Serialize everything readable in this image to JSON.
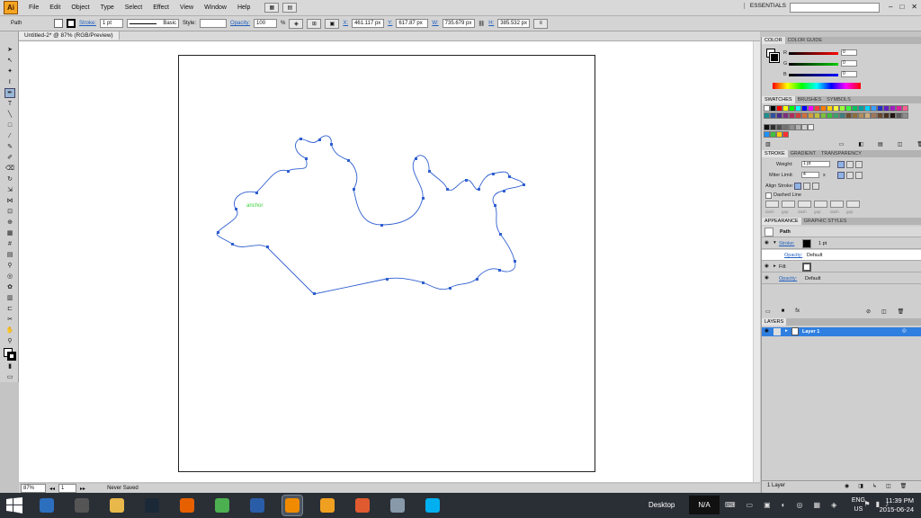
{
  "app": {
    "logo": "Ai"
  },
  "menu": [
    "File",
    "Edit",
    "Object",
    "Type",
    "Select",
    "Effect",
    "View",
    "Window",
    "Help"
  ],
  "workspace": "ESSENTIALS",
  "search_placeholder": "",
  "control": {
    "selection": "Path",
    "stroke_label": "Stroke:",
    "stroke_weight": "1 pt",
    "brush": "Basic",
    "style_label": "Style:",
    "opacity_label": "Opacity:",
    "opacity_value": "100",
    "opacity_unit": "%",
    "x_label": "X:",
    "x_value": "461.117 px",
    "y_label": "Y:",
    "y_value": "617.87 px",
    "w_label": "W:",
    "w_value": "735.679 px",
    "h_label": "H:",
    "h_value": "385.532 px"
  },
  "document": {
    "tab": "Untitled-2* @ 87% (RGB/Preview)",
    "zoom": "87%",
    "artboard": "1",
    "status": "Never Saved",
    "anchor_hint": "anchor"
  },
  "color_panel": {
    "tabs": [
      "COLOR",
      "COLOR GUIDE"
    ],
    "channels": [
      {
        "label": "R",
        "value": "0",
        "color": "#d02020"
      },
      {
        "label": "G",
        "value": "0",
        "color": "#20a020"
      },
      {
        "label": "B",
        "value": "0",
        "color": "#2030d0"
      }
    ]
  },
  "swatches_panel": {
    "tabs": [
      "SWATCHES",
      "BRUSHES",
      "SYMBOLS"
    ],
    "row1": [
      "#ffffff",
      "#000000",
      "#ff0000",
      "#ffff00",
      "#00ff00",
      "#00ffff",
      "#0000ff",
      "#ff00ff",
      "#ff3b3b",
      "#ff7a00",
      "#ffd200",
      "#ffff3b",
      "#9fff3b",
      "#3bff3b",
      "#00c060",
      "#00a0a0",
      "#00d0ff",
      "#3b9fff",
      "#2030c0",
      "#6020c0",
      "#a020c0",
      "#e020a0",
      "#ff6090"
    ],
    "row2": [
      "#1e8f8f",
      "#2f4f9f",
      "#4b2f8f",
      "#7f2f7f",
      "#af2f5f",
      "#cf3f3f",
      "#cf6f3f",
      "#cf9f3f",
      "#bfbf3f",
      "#7fbf3f",
      "#3fbf3f",
      "#3f9f6f",
      "#3f7f7f",
      "#6f4f2f",
      "#8f6f3f",
      "#af8f5f",
      "#cfaf7f",
      "#a0785a",
      "#6b4a2e",
      "#4a3320",
      "#201510",
      "#5a5a5a",
      "#8c8c8c"
    ],
    "row3": [
      "#101010",
      "#303030",
      "#505050",
      "#707070",
      "#909090",
      "#b0b0b0",
      "#d0d0d0",
      "#f0f0f0"
    ],
    "row4": [
      "#1e90ff",
      "#40c040",
      "#ffcc00",
      "#ff3030"
    ]
  },
  "stroke_panel": {
    "tabs": [
      "STROKE",
      "GRADIENT",
      "TRANSPARENCY"
    ],
    "weight_label": "Weight:",
    "weight_value": "1 pt",
    "miter_label": "Miter Limit:",
    "miter_value": "4",
    "miter_unit": "x",
    "align_label": "Align Stroke:",
    "dashed_label": "Dashed Line",
    "dash_labels": [
      "dash",
      "gap",
      "dash",
      "gap",
      "dash",
      "gap"
    ]
  },
  "appearance_panel": {
    "tabs": [
      "APPEARANCE",
      "GRAPHIC STYLES"
    ],
    "item": "Path",
    "stroke_label": "Stroke:",
    "stroke_value": "1 pt",
    "opacity1_label": "Opacity:",
    "opacity1_value": "Default",
    "fill_label": "Fill:",
    "opacity2_label": "Opacity:",
    "opacity2_value": "Default"
  },
  "layers_panel": {
    "tab": "LAYERS",
    "layer": "Layer 1",
    "count": "1 Layer"
  },
  "taskbar": {
    "desktop": "Desktop",
    "na": "N/A",
    "lang1": "ENG",
    "lang2": "US",
    "time": "11:39 PM",
    "date": "2015-06-24",
    "apps": [
      {
        "name": "windows",
        "color": "#1e88e5"
      },
      {
        "name": "pen",
        "color": "#2c6fbf"
      },
      {
        "name": "film",
        "color": "#555"
      },
      {
        "name": "folder",
        "color": "#e8b84a"
      },
      {
        "name": "steam",
        "color": "#1b2838"
      },
      {
        "name": "firefox",
        "color": "#e66000"
      },
      {
        "name": "chrome",
        "color": "#4caf50"
      },
      {
        "name": "photoshop",
        "color": "#2a5da8"
      },
      {
        "name": "illustrator",
        "color": "#f08a00"
      },
      {
        "name": "media",
        "color": "#f0a020"
      },
      {
        "name": "tumblr",
        "color": "#e05a30"
      },
      {
        "name": "calculator",
        "color": "#8899aa"
      },
      {
        "name": "skype",
        "color": "#00aff0"
      }
    ]
  }
}
